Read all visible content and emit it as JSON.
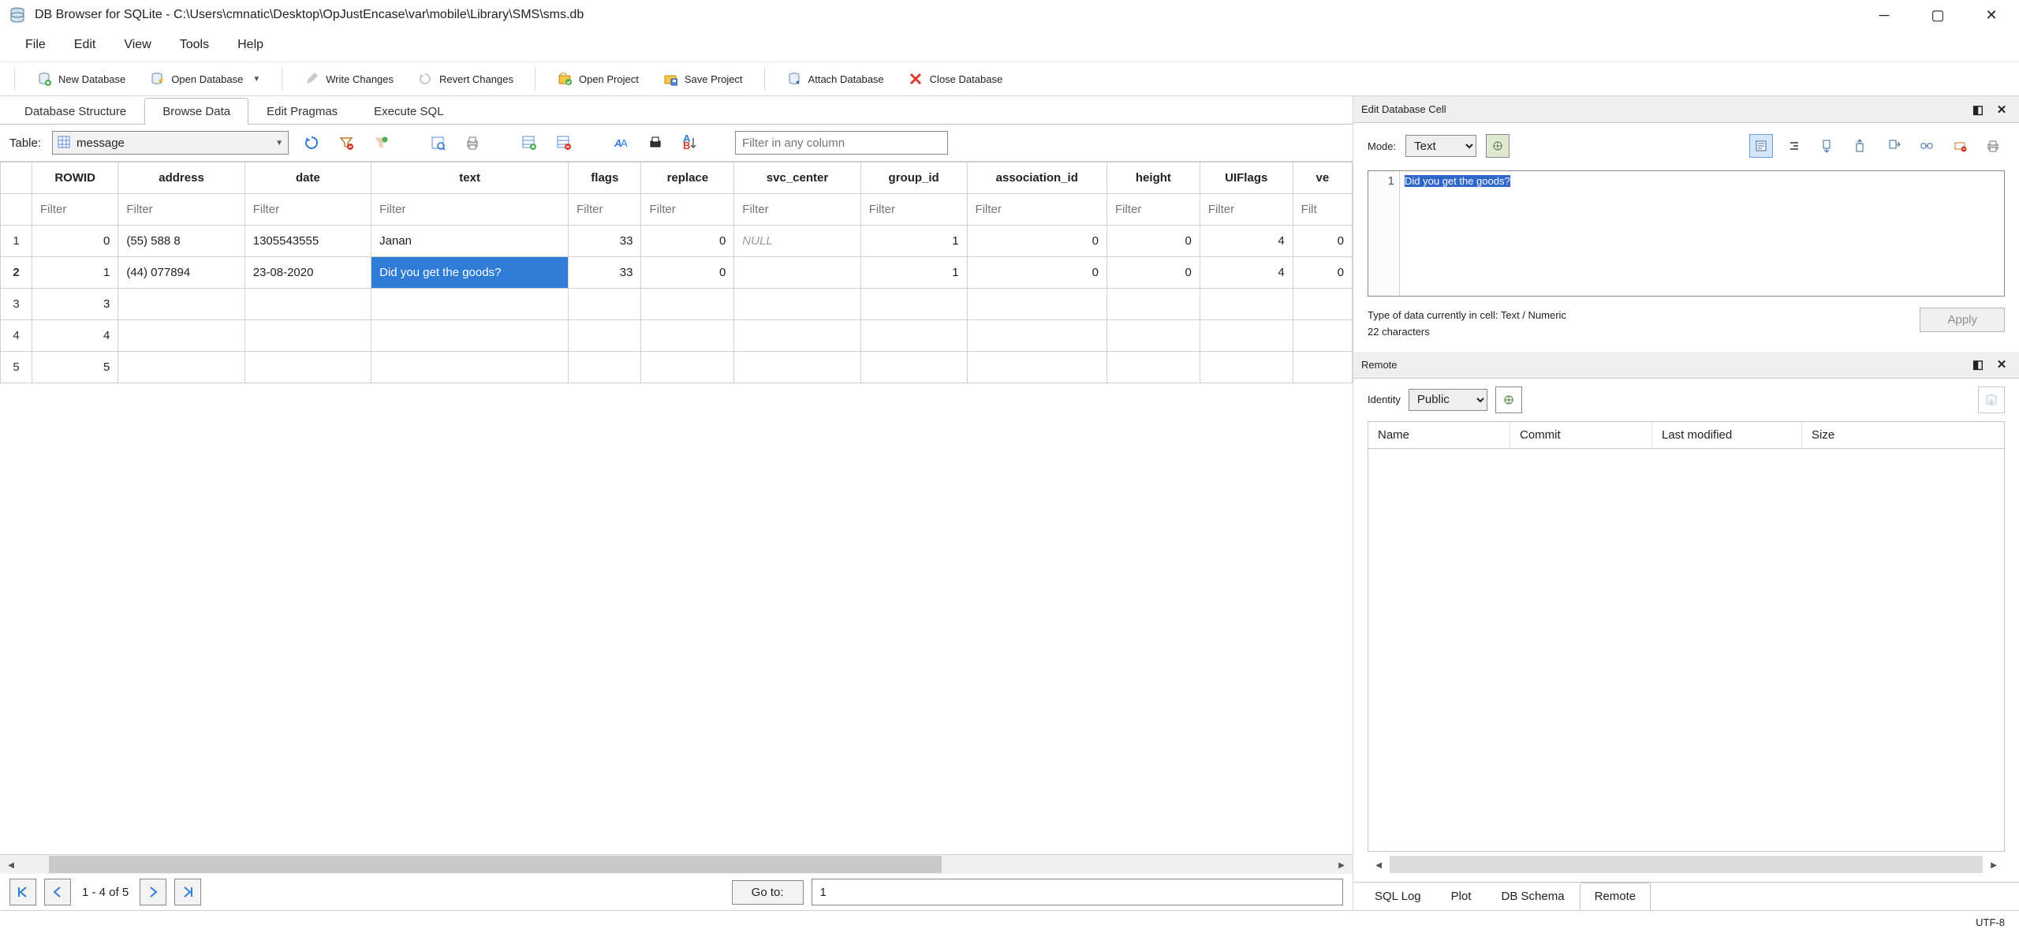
{
  "window": {
    "title": "DB Browser for SQLite - C:\\Users\\cmnatic\\Desktop\\OpJustEncase\\var\\mobile\\Library\\SMS\\sms.db"
  },
  "menu": {
    "items": [
      "File",
      "Edit",
      "View",
      "Tools",
      "Help"
    ]
  },
  "toolbar": {
    "new_db": "New Database",
    "open_db": "Open Database",
    "write_changes": "Write Changes",
    "revert_changes": "Revert Changes",
    "open_project": "Open Project",
    "save_project": "Save Project",
    "attach_db": "Attach Database",
    "close_db": "Close Database"
  },
  "tabs": {
    "structure": "Database Structure",
    "browse": "Browse Data",
    "pragmas": "Edit Pragmas",
    "sql": "Execute SQL"
  },
  "table_selector": {
    "label": "Table:",
    "value": "message",
    "filter_placeholder": "Filter in any column"
  },
  "grid": {
    "headers": [
      "ROWID",
      "address",
      "date",
      "text",
      "flags",
      "replace",
      "svc_center",
      "group_id",
      "association_id",
      "height",
      "UIFlags",
      "ve"
    ],
    "filter_label": "Filter",
    "filter_short": "Filt",
    "rows": [
      {
        "n": "1",
        "bold": false,
        "cells": [
          "0",
          "(55) 588 8",
          "1305543555",
          "Janan",
          "33",
          "0",
          "NULL",
          "1",
          "0",
          "0",
          "4",
          "0"
        ],
        "null_cols": [
          6
        ]
      },
      {
        "n": "2",
        "bold": true,
        "cells": [
          "1",
          "(44) 077894",
          "23-08-2020",
          "Did you get the goods?",
          "33",
          "0",
          "",
          "1",
          "0",
          "0",
          "4",
          "0"
        ],
        "sel_col": 3
      },
      {
        "n": "3",
        "bold": false,
        "cells": [
          "3",
          "",
          "",
          "",
          "",
          "",
          "",
          "",
          "",
          "",
          "",
          ""
        ]
      },
      {
        "n": "4",
        "bold": false,
        "cells": [
          "4",
          "",
          "",
          "",
          "",
          "",
          "",
          "",
          "",
          "",
          "",
          ""
        ]
      },
      {
        "n": "5",
        "bold": false,
        "cells": [
          "5",
          "",
          "",
          "",
          "",
          "",
          "",
          "",
          "",
          "",
          "",
          ""
        ]
      }
    ]
  },
  "pager": {
    "info": "1 - 4 of 5",
    "goto_label": "Go to:",
    "goto_value": "1"
  },
  "edit_panel": {
    "title": "Edit Database Cell",
    "mode_label": "Mode:",
    "mode_value": "Text",
    "line_no": "1",
    "content": "Did you get the goods?",
    "type_line": "Type of data currently in cell: Text / Numeric",
    "count_line": "22 characters",
    "apply": "Apply"
  },
  "remote_panel": {
    "title": "Remote",
    "identity_label": "Identity",
    "identity_value": "Public",
    "cols": {
      "name": "Name",
      "commit": "Commit",
      "modified": "Last modified",
      "size": "Size"
    }
  },
  "bottom_tabs": {
    "log": "SQL Log",
    "plot": "Plot",
    "schema": "DB Schema",
    "remote": "Remote"
  },
  "status": {
    "encoding": "UTF-8"
  },
  "colors": {
    "selection": "#2e7cd6",
    "panel": "#efefef",
    "border": "#c7c7c7"
  }
}
